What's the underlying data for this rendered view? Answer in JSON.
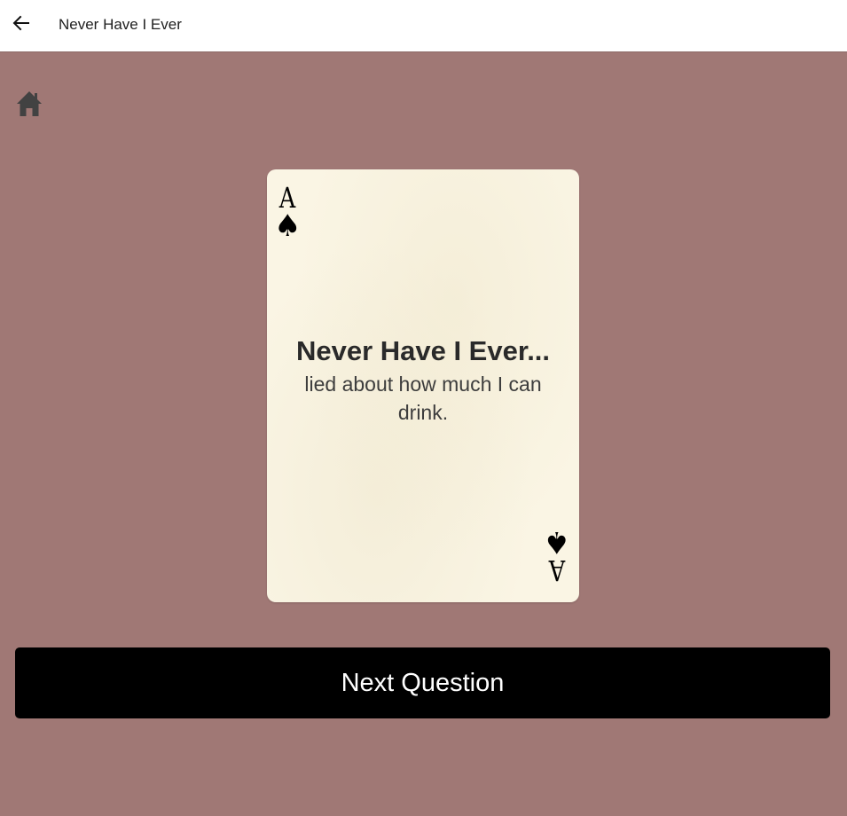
{
  "window": {
    "title": "Never Have I Ever",
    "back_icon": "arrow-left-icon"
  },
  "toolbar": {
    "home_icon": "home-icon"
  },
  "card": {
    "rank": "A",
    "suit": "♠",
    "heading": "Never Have I Ever...",
    "question": "lied about how much I can drink."
  },
  "actions": {
    "next_label": "Next Question"
  },
  "colors": {
    "background": "#a07875",
    "card": "#faf5e4",
    "button": "#000000",
    "button_text": "#ffffff"
  }
}
